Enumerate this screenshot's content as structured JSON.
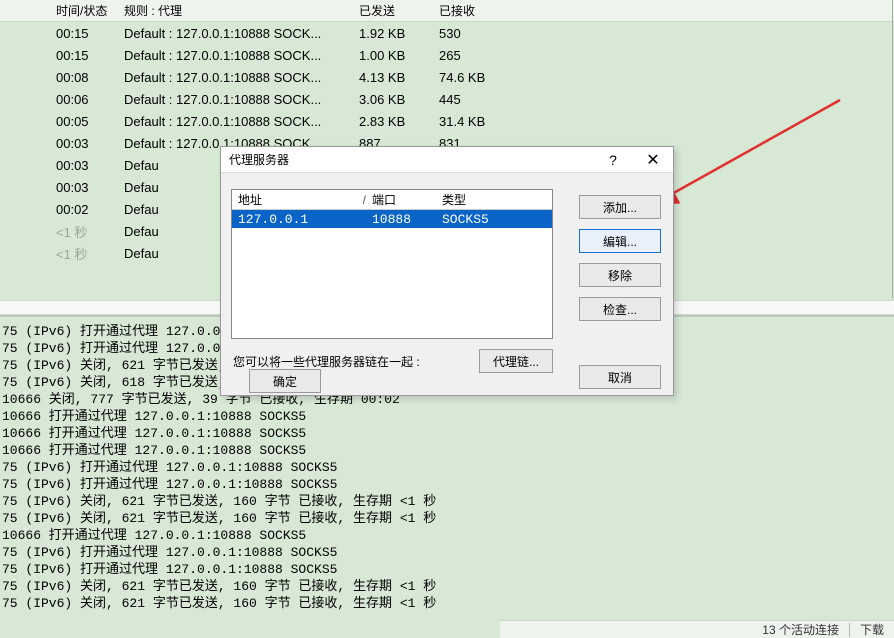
{
  "table": {
    "headers": {
      "time": "时间/状态",
      "rule": "规则 : 代理",
      "sent": "已发送",
      "recv": "已接收"
    },
    "rows": [
      {
        "time": "00:15",
        "rule": "Default : 127.0.0.1:10888 SOCK...",
        "sent": "1.92 KB",
        "recv": "530"
      },
      {
        "time": "00:15",
        "rule": "Default : 127.0.0.1:10888 SOCK...",
        "sent": "1.00 KB",
        "recv": "265"
      },
      {
        "time": "00:08",
        "rule": "Default : 127.0.0.1:10888 SOCK...",
        "sent": "4.13 KB",
        "recv": "74.6 KB"
      },
      {
        "time": "00:06",
        "rule": "Default : 127.0.0.1:10888 SOCK...",
        "sent": "3.06 KB",
        "recv": "445"
      },
      {
        "time": "00:05",
        "rule": "Default : 127.0.0.1:10888 SOCK...",
        "sent": "2.83 KB",
        "recv": "31.4 KB"
      },
      {
        "time": "00:03",
        "rule": "Default : 127.0.0.1:10888 SOCK...",
        "sent": "887",
        "recv": "831"
      },
      {
        "time": "00:03",
        "rule": "Defau",
        "sent": "",
        "recv": ""
      },
      {
        "time": "00:03",
        "rule": "Defau",
        "sent": "",
        "recv": ""
      },
      {
        "time": "00:02",
        "rule": "Defau",
        "sent": "",
        "recv": ""
      },
      {
        "time": "<1 秒",
        "rule": "Defau",
        "sent": "",
        "recv": "",
        "gray": true
      },
      {
        "time": "<1 秒",
        "rule": "Defau",
        "sent": "",
        "recv": "",
        "gray": true
      }
    ]
  },
  "log_lines": [
    "75 (IPv6) 打开通过代理 127.0.0.1:1088",
    "75 (IPv6) 打开通过代理 127.0.0.1:1088",
    "75 (IPv6) 关闭, 621 字节已发送, 160 字",
    "75 (IPv6) 关闭, 618 字节已发送, 10034",
    "10666 关闭, 777 字节已发送, 39 字节 已接收, 生存期 00:02",
    "10666 打开通过代理 127.0.0.1:10888 SOCKS5",
    "10666 打开通过代理 127.0.0.1:10888 SOCKS5",
    "10666 打开通过代理 127.0.0.1:10888 SOCKS5",
    "75 (IPv6) 打开通过代理 127.0.0.1:10888 SOCKS5",
    "75 (IPv6) 打开通过代理 127.0.0.1:10888 SOCKS5",
    "75 (IPv6) 关闭, 621 字节已发送, 160 字节 已接收, 生存期 <1 秒",
    "75 (IPv6) 关闭, 621 字节已发送, 160 字节 已接收, 生存期 <1 秒",
    "10666 打开通过代理 127.0.0.1:10888 SOCKS5",
    "75 (IPv6) 打开通过代理 127.0.0.1:10888 SOCKS5",
    "75 (IPv6) 打开通过代理 127.0.0.1:10888 SOCKS5",
    "75 (IPv6) 关闭, 621 字节已发送, 160 字节 已接收, 生存期 <1 秒",
    "75 (IPv6) 关闭, 621 字节已发送, 160 字节 已接收, 生存期 <1 秒"
  ],
  "status": {
    "active": "13 个活动连接",
    "download": "下载"
  },
  "dialog": {
    "title": "代理服务器",
    "list_headers": {
      "addr": "地址",
      "port": "端口",
      "type": "类型",
      "sort_glyph": "/"
    },
    "row": {
      "addr": "127.0.0.1",
      "port": "10888",
      "type": "SOCKS5"
    },
    "hint": "您可以将一些代理服务器链在一起 :",
    "buttons": {
      "add": "添加...",
      "edit": "编辑...",
      "remove": "移除",
      "check": "检查...",
      "chain": "代理链...",
      "ok": "确定",
      "cancel": "取消",
      "help": "?",
      "close": "✕"
    }
  }
}
